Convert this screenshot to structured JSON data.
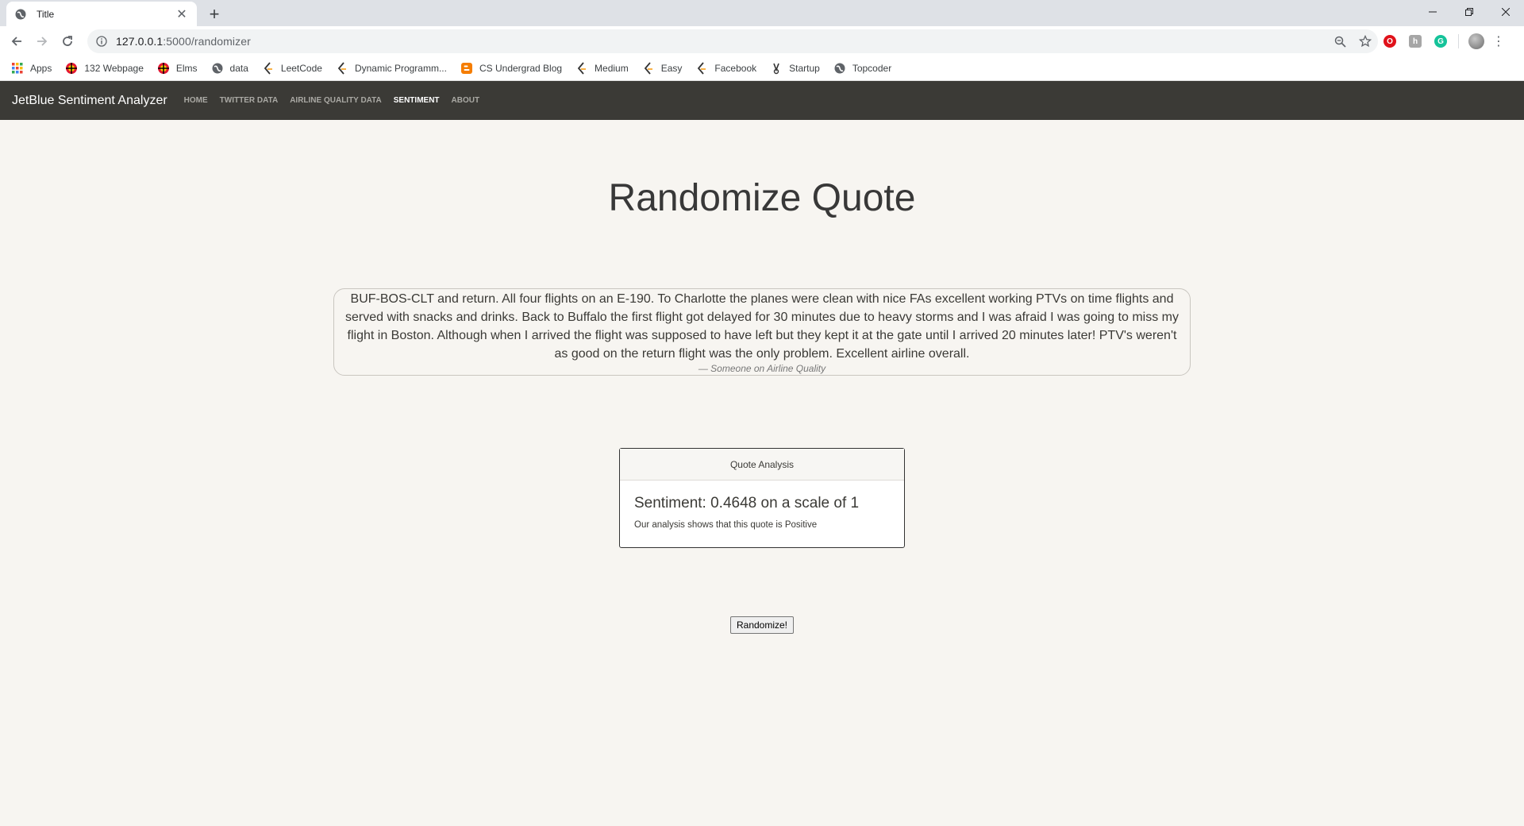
{
  "browser": {
    "tab_title": "Title",
    "url_host": "127.0.0.1",
    "url_path": ":5000/randomizer",
    "bookmarks": [
      {
        "label": "Apps",
        "icon": "apps-grid-icon"
      },
      {
        "label": "132 Webpage",
        "icon": "umd-globe-icon"
      },
      {
        "label": "Elms",
        "icon": "umd-globe-icon"
      },
      {
        "label": "data",
        "icon": "globe-icon"
      },
      {
        "label": "LeetCode",
        "icon": "leetcode-icon"
      },
      {
        "label": "Dynamic Programm...",
        "icon": "leetcode-icon"
      },
      {
        "label": "CS Undergrad Blog",
        "icon": "blogger-icon"
      },
      {
        "label": "Medium",
        "icon": "leetcode-icon"
      },
      {
        "label": "Easy",
        "icon": "leetcode-icon"
      },
      {
        "label": "Facebook",
        "icon": "leetcode-icon"
      },
      {
        "label": "Startup",
        "icon": "startup-icon"
      },
      {
        "label": "Topcoder",
        "icon": "globe-icon"
      }
    ]
  },
  "site": {
    "brand": "JetBlue Sentiment Analyzer",
    "nav": [
      "HOME",
      "TWITTER DATA",
      "AIRLINE QUALITY DATA",
      "SENTIMENT",
      "ABOUT"
    ],
    "active_nav": "SENTIMENT"
  },
  "main": {
    "title": "Randomize Quote",
    "quote_text": "BUF-BOS-CLT and return. All four flights on an E-190. To Charlotte the planes were clean with nice FAs excellent working PTVs on time flights and served with snacks and drinks. Back to Buffalo the first flight got delayed for 30 minutes due to heavy storms and I was afraid I was going to miss my flight in Boston. Although when I arrived the flight was supposed to have left but they kept it at the gate until I arrived 20 minutes later! PTV's weren't as good on the return flight was the only problem. Excellent airline overall.",
    "quote_source": "— Someone on Airline Quality",
    "card_header": "Quote Analysis",
    "card_title": "Sentiment: 0.4648 on a scale of 1",
    "card_text": "Our analysis shows that this quote is Positive",
    "button_label": "Randomize!"
  }
}
